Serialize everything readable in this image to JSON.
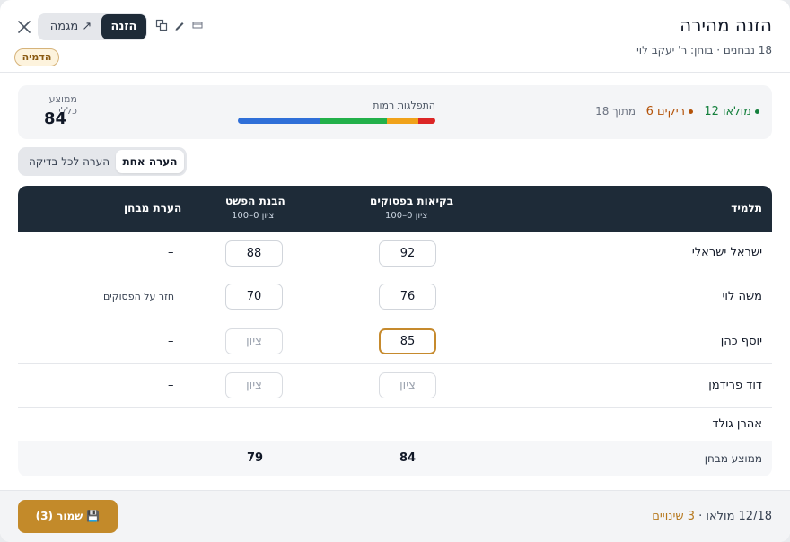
{
  "header": {
    "title": "הזנה מהירה",
    "subtitle": "18 נבחנים · בוחן: ר' יעקב לוי",
    "mode_input": "הזנה",
    "mode_trend": "↗ מגמה",
    "demo_badge": "הדמיה",
    "icons": [
      "close-icon",
      "copy-icon",
      "pencil-icon",
      "window-icon"
    ]
  },
  "stats": {
    "filled": "מולאו 12",
    "empty": "ריקים 6",
    "of_total": "מתוך 18",
    "distribution_label": "התפלגות רמות",
    "distribution": [
      {
        "color": "#2f6fd8",
        "fraction": 0.415
      },
      {
        "color": "#22b04a",
        "fraction": 0.34
      },
      {
        "color": "#f0a21a",
        "fraction": 0.16
      },
      {
        "color": "#dc2626",
        "fraction": 0.085
      }
    ],
    "overall_avg_label": "ממוצע כללי",
    "overall_avg": "84",
    "colors": {
      "filled": "#15803d",
      "empty": "#b45309"
    }
  },
  "comment_toggle": {
    "one": "הערה אחת",
    "each": "הערה לכל בדיקה"
  },
  "table": {
    "col_student": "תלמיד",
    "col_fluency": "בקיאות בפסוקים",
    "col_fluency_sub": "ציון 0–100",
    "col_understanding": "הבנת הפשט",
    "col_understanding_sub": "ציון 0–100",
    "col_note": "הערת מבחן",
    "grade_placeholder": "ציון",
    "rows": [
      {
        "name": "ישראל ישראלי",
        "fluency": "92",
        "understanding": "88",
        "note": "–"
      },
      {
        "name": "משה לוי",
        "fluency": "76",
        "understanding": "70",
        "note": "חזר על הפסוקים"
      },
      {
        "name": "יוסף כהן",
        "fluency": "85",
        "understanding": "",
        "note": "–"
      },
      {
        "name": "דוד פרידמן",
        "fluency": "",
        "understanding": "",
        "note": "–"
      },
      {
        "name": "אהרן גולד",
        "fluency": "–",
        "understanding": "–",
        "note": "–"
      }
    ],
    "avg_label": "ממוצע מבחן",
    "avg_fluency": "84",
    "avg_understanding": "79"
  },
  "footer": {
    "save_label": "💾 שמור (3)",
    "filled_status": "12/18 מולאו",
    "separator": " · ",
    "changes": "3 שינויים",
    "accent": "#c38a2a"
  }
}
